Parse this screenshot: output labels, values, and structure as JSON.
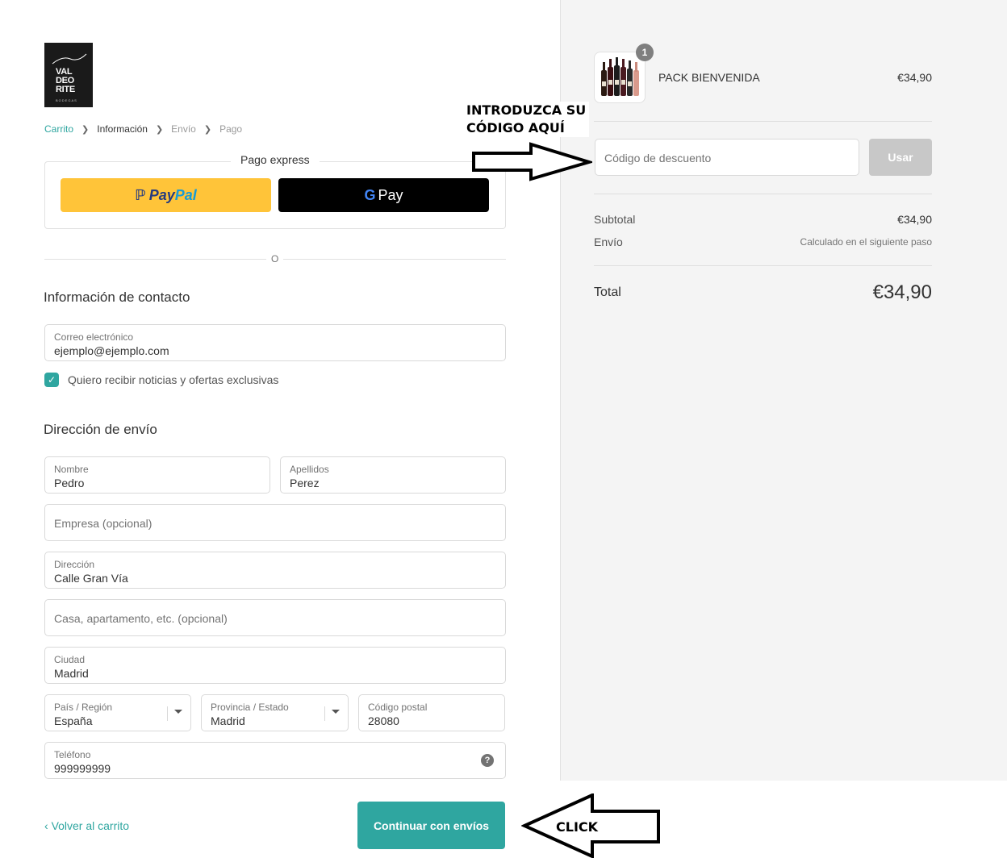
{
  "logo": {
    "text": "VAL DEO RITE",
    "subtext": "BODEGAS"
  },
  "breadcrumb": {
    "items": [
      "Carrito",
      "Información",
      "Envío",
      "Pago"
    ]
  },
  "express": {
    "title": "Pago express",
    "paypal_a": "Pay",
    "paypal_b": "Pal",
    "gpay_label": "Pay"
  },
  "divider_text": "O",
  "contact": {
    "title": "Información de contacto",
    "email_label": "Correo electrónico",
    "email_value": "ejemplo@ejemplo.com",
    "newsletter_label": "Quiero recibir noticias y ofertas exclusivas"
  },
  "shipping": {
    "title": "Dirección de envío",
    "first_name_label": "Nombre",
    "first_name_value": "Pedro",
    "last_name_label": "Apellidos",
    "last_name_value": "Perez",
    "company_placeholder": "Empresa (opcional)",
    "address_label": "Dirección",
    "address_value": "Calle Gran Vía",
    "apartment_placeholder": "Casa, apartamento, etc. (opcional)",
    "city_label": "Ciudad",
    "city_value": "Madrid",
    "country_label": "País / Región",
    "country_value": "España",
    "province_label": "Provincia / Estado",
    "province_value": "Madrid",
    "postal_label": "Código postal",
    "postal_value": "28080",
    "phone_label": "Teléfono",
    "phone_value": "999999999"
  },
  "footer": {
    "back_label": "Volver al carrito",
    "continue_label": "Continuar con envíos"
  },
  "summary": {
    "badge": "1",
    "product_name": "PACK BIENVENIDA",
    "product_price": "€34,90",
    "discount_placeholder": "Código de descuento",
    "use_label": "Usar",
    "subtotal_label": "Subtotal",
    "subtotal_value": "€34,90",
    "shipping_label": "Envío",
    "shipping_value": "Calculado en el siguiente paso",
    "total_label": "Total",
    "total_value": "€34,90"
  },
  "annotations": {
    "code_line1": "INTRODUZCA SU",
    "code_line2": "CÓDIGO AQUÍ",
    "click": "CLICK"
  },
  "colors": {
    "accent": "#2fa6a0",
    "paypal": "#ffc439",
    "gpay": "#000000"
  }
}
